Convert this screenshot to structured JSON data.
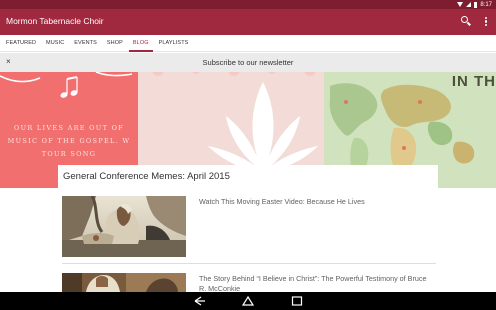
{
  "status_bar": {
    "time": "8:17",
    "icons": [
      "wifi-icon",
      "signal-icon",
      "battery-icon"
    ]
  },
  "app_bar": {
    "title": "Mormon Tabernacle Choir",
    "icons": [
      "search-icon",
      "more-vert-icon"
    ]
  },
  "tabs": [
    {
      "label": "FEATURED",
      "active": false
    },
    {
      "label": "MUSIC",
      "active": false
    },
    {
      "label": "EVENTS",
      "active": false
    },
    {
      "label": "SHOP",
      "active": false
    },
    {
      "label": "BLOG",
      "active": true
    },
    {
      "label": "PLAYLISTS",
      "active": false
    }
  ],
  "newsletter": {
    "close_symbol": "×",
    "text": "Subscribe to our newsletter"
  },
  "hero": {
    "quote_lines": [
      "OUR LIVES ARE OUT OF",
      "MUSIC OF THE GOSPEL. W",
      "TOUR SONG"
    ],
    "map_text": "IN TH"
  },
  "featured": {
    "title": "General Conference Memes: April 2015"
  },
  "articles": [
    {
      "title": "Watch This Moving Easter Video: Because He Lives"
    },
    {
      "title": "The Story Behind “I Believe in Christ”: The Powerful Testimony of Bruce R. McConkie"
    }
  ],
  "nav_bar": {
    "icons": [
      "back-icon",
      "home-icon",
      "recent-apps-icon"
    ]
  },
  "colors": {
    "status_bar": "#7e1d2f",
    "app_bar": "#a0283f",
    "accent": "#a0283f",
    "newsletter_bg": "#ebebeb",
    "hero_pink": "#f26f6f",
    "hero_middle": "#f3dcd7",
    "hero_map": "#d1e2be"
  }
}
